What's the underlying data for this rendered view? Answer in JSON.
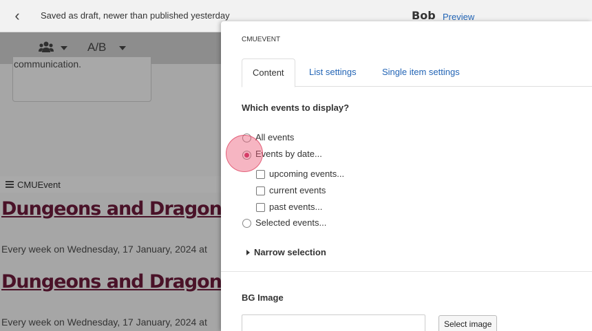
{
  "header": {
    "status": "Saved as draft, newer than published yesterday",
    "user": "Bob",
    "preview_label": "Preview"
  },
  "toolbar": {
    "variant_label": "A/B"
  },
  "page": {
    "card_text": "communication.",
    "block_label": "CMUEvent",
    "events": [
      {
        "title": "Dungeons and Dragons:",
        "date": "Every week on Wednesday, 17 January, 2024 at"
      },
      {
        "title": "Dungeons and Dragons:",
        "date": "Every week on Wednesday, 17 January, 2024 at"
      }
    ]
  },
  "modal": {
    "label": "CMUEVENT",
    "tabs": [
      {
        "label": "Content",
        "active": true
      },
      {
        "label": "List settings",
        "active": false
      },
      {
        "label": "Single item settings",
        "active": false
      }
    ],
    "question": "Which events to display?",
    "options": {
      "all": "All events",
      "by_date": "Events by date...",
      "upcoming": "upcoming events...",
      "current": "current events",
      "past": "past events...",
      "selected": "Selected events..."
    },
    "selected_option": "by_date",
    "narrow": "Narrow selection",
    "bg_image_label": "BG Image",
    "select_image": "Select image"
  }
}
